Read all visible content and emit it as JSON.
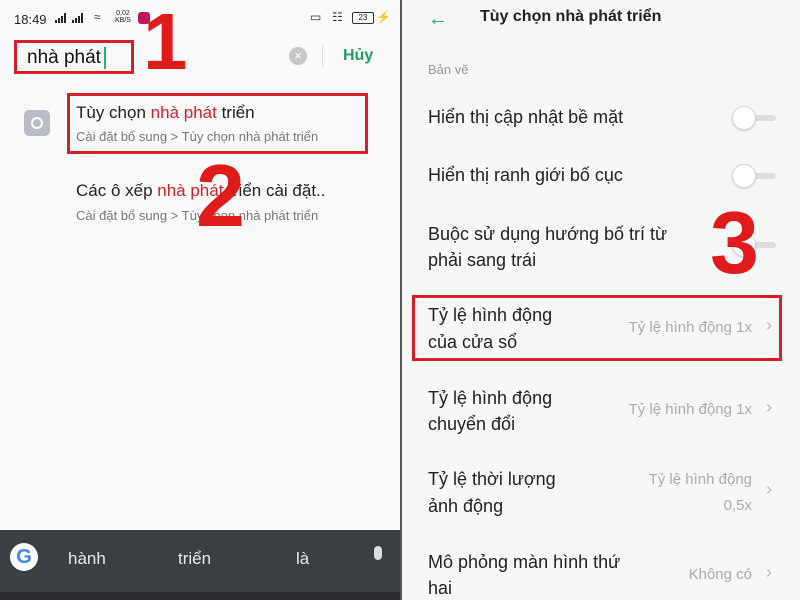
{
  "left": {
    "status_bar": {
      "time": "18:49",
      "speed_value": "0,02",
      "speed_unit": "KB/S",
      "battery": "23"
    },
    "search": {
      "query": "nhà phát",
      "cancel_label": "Hủy"
    },
    "step_numbers": [
      "1",
      "2"
    ],
    "results": [
      {
        "title_prefix": "Tùy chọn ",
        "title_highlight": "nhà phát",
        "title_suffix": " triển",
        "subtitle": "Cài đặt bổ sung > Tùy chọn nhà phát triển"
      },
      {
        "title_prefix": "Các ô xếp ",
        "title_highlight": "nhà phát",
        "title_suffix": " triển cài đặt..",
        "subtitle": "Cài đặt bổ sung > Tùy chọn nhà phát triển"
      }
    ],
    "keyboard": {
      "suggestions": [
        "hành",
        "triển",
        "là"
      ]
    }
  },
  "right": {
    "title": "Tùy chọn nhà phát triển",
    "section_label": "Bản vẽ",
    "step_number": "3",
    "rows": [
      {
        "label_lines": [
          "Hiển thị cập nhật bề mặt"
        ],
        "toggle": false
      },
      {
        "label_lines": [
          "Hiển thị ranh giới bố cục"
        ],
        "toggle": false
      },
      {
        "label_lines": [
          "Buộc sử dụng hướng bố trí từ",
          "phải sang trái"
        ],
        "toggle": false
      },
      {
        "label_lines": [
          "Tỷ lệ hình động",
          "của cửa sổ"
        ],
        "value_lines": [
          "Tỷ lệ hình động 1x"
        ]
      },
      {
        "label_lines": [
          "Tỷ lệ hình động",
          "chuyển đổi"
        ],
        "value_lines": [
          "Tỷ lệ hình động 1x"
        ]
      },
      {
        "label_lines": [
          "Tỷ lệ thời lượng",
          "ảnh động"
        ],
        "value_lines": [
          "Tỷ lệ hình động",
          "0,5x"
        ]
      },
      {
        "label_lines": [
          "Mô phỏng màn hình thứ",
          "hai"
        ],
        "value_lines": [
          "Không có"
        ]
      }
    ]
  },
  "colors": {
    "accent_green": "#1ea060",
    "annotation_red": "#d62027",
    "highlight_text": "#d62027"
  }
}
